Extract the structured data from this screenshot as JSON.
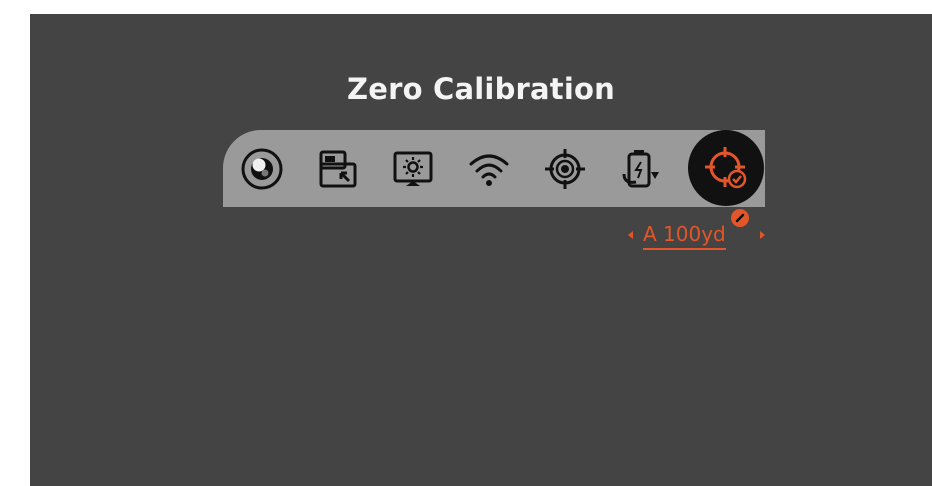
{
  "screen": {
    "title": "Zero Calibration"
  },
  "toolbar": {
    "items": [
      {
        "icon": "image-mode-icon",
        "active": false
      },
      {
        "icon": "picture-in-picture-icon",
        "active": false
      },
      {
        "icon": "display-brightness-icon",
        "active": false
      },
      {
        "icon": "wifi-icon",
        "active": false
      },
      {
        "icon": "reticle-icon",
        "active": false
      },
      {
        "icon": "battery-charge-icon",
        "active": false
      },
      {
        "icon": "zero-calibration-icon",
        "active": true
      }
    ]
  },
  "zero_profile": {
    "label": "A 100yd",
    "edit_icon": "pencil-icon"
  },
  "colors": {
    "background": "#444444",
    "toolbar": "#9a9a9a",
    "active_tile": "#111111",
    "accent": "#e2562a",
    "title": "#f4f4f4"
  }
}
